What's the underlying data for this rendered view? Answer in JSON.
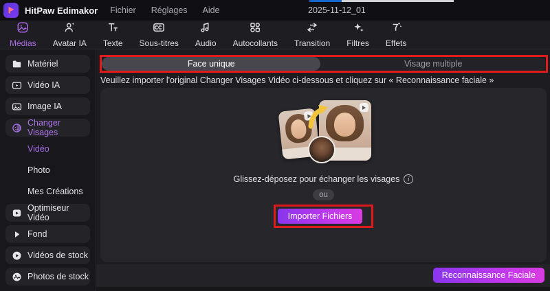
{
  "colors": {
    "accent_purple": "#ab74e8",
    "annotation_red": "#de1c1c",
    "button_gradient_start": "#8a35ee",
    "button_gradient_end": "#d83ce0"
  },
  "titlebar": {
    "app_title": "HitPaw Edimakor",
    "menus": [
      {
        "label": "Fichier"
      },
      {
        "label": "Réglages"
      },
      {
        "label": "Aide"
      }
    ],
    "project_name": "2025-11-12_01"
  },
  "toolbar": {
    "items": [
      {
        "label": "Médias",
        "icon": "media-icon",
        "active": true
      },
      {
        "label": "Avatar IA",
        "icon": "avatar-ai-icon",
        "active": false
      },
      {
        "label": "Texte",
        "icon": "text-icon",
        "active": false
      },
      {
        "label": "Sous-titres",
        "icon": "subtitles-icon",
        "active": false
      },
      {
        "label": "Audio",
        "icon": "audio-icon",
        "active": false
      },
      {
        "label": "Autocollants",
        "icon": "stickers-icon",
        "active": false
      },
      {
        "label": "Transition",
        "icon": "transition-icon",
        "active": false
      },
      {
        "label": "Filtres",
        "icon": "filters-icon",
        "active": false
      },
      {
        "label": "Effets",
        "icon": "effects-icon",
        "active": false
      }
    ]
  },
  "sidebar": {
    "items": [
      {
        "label": "Matériel",
        "icon": "folder-icon",
        "type": "pill",
        "active": false
      },
      {
        "label": "Vidéo IA",
        "icon": "video-ai-icon",
        "type": "pill",
        "active": false
      },
      {
        "label": "Image IA",
        "icon": "image-ai-icon",
        "type": "pill",
        "active": false
      },
      {
        "label": "Changer Visages",
        "icon": "face-swap-icon",
        "type": "pill",
        "active": true
      },
      {
        "label": "Vidéo",
        "type": "sub",
        "active": true
      },
      {
        "label": "Photo",
        "type": "sub",
        "active": false
      },
      {
        "label": "Mes Créations",
        "type": "sub",
        "active": false
      },
      {
        "label": "Optimiseur Vidéo",
        "icon": "video-enhance-icon",
        "type": "pill",
        "active": false
      },
      {
        "label": "Fond",
        "icon": "play-triangle-icon",
        "type": "pill",
        "active": false
      },
      {
        "label": "Vidéos de stock",
        "icon": "stock-video-icon",
        "type": "pill",
        "active": false
      },
      {
        "label": "Photos de stock",
        "icon": "stock-photo-icon",
        "type": "pill",
        "active": false
      }
    ]
  },
  "main": {
    "tabs": [
      {
        "label": "Face unique",
        "active": true
      },
      {
        "label": "Visage multiple",
        "active": false
      }
    ],
    "instruction": "Veuillez importer l'original Changer Visages Vidéo ci-dessous et cliquez sur « Reconnaissance faciale »",
    "dropzone": {
      "hint": "Glissez-déposez pour échanger les visages",
      "or_label": "ou",
      "import_button": "Importer Fichiers"
    },
    "footer": {
      "recognize_button": "Reconnaissance Faciale"
    }
  }
}
